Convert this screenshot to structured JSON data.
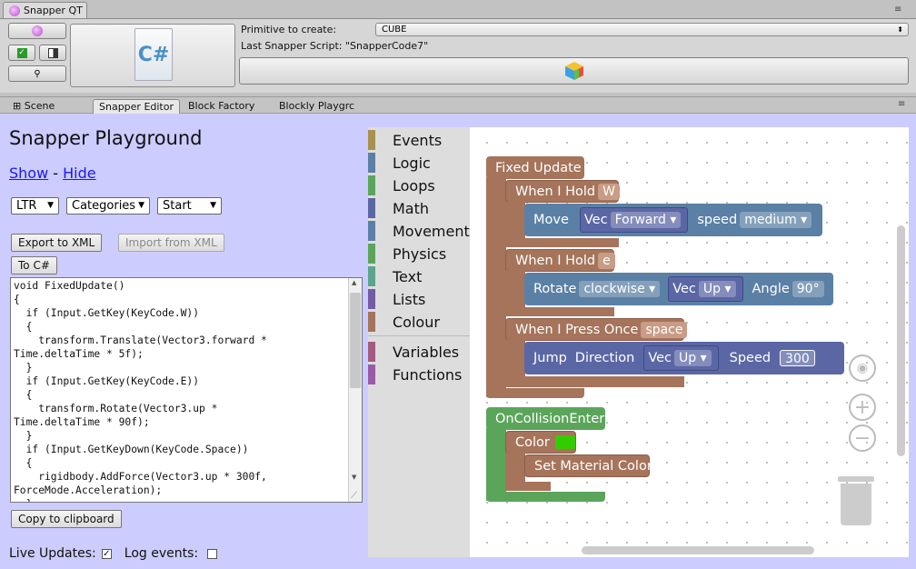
{
  "window": {
    "title": "Snapper QT"
  },
  "toolbar": {
    "primitive_label": "Primitive to create:",
    "primitive_value": "CUBE",
    "last_script_label": "Last Snapper Script: \"SnapperCode7\"",
    "csharp_icon": "C#"
  },
  "tabs": [
    "Scene",
    "Snapper Editor",
    "Block Factory",
    "Blockly Playgrc"
  ],
  "playground": {
    "title": "Snapper Playground",
    "show": "Show",
    "sep": " - ",
    "hide": "Hide",
    "dir_select": "LTR",
    "cat_select": "Categories",
    "start_select": "Start",
    "export_btn": "Export to XML",
    "import_btn": "Import from XML",
    "tocs_btn": "To C#",
    "copy_btn": "Copy to clipboard",
    "live_label": "Live Updates:",
    "log_label": "Log events:",
    "live_checked": true,
    "log_checked": false,
    "code": "void FixedUpdate()\n{\n  if (Input.GetKey(KeyCode.W))\n  {\n    transform.Translate(Vector3.forward *\nTime.deltaTime * 5f);\n  }\n  if (Input.GetKey(KeyCode.E))\n  {\n    transform.Rotate(Vector3.up *\nTime.deltaTime * 90f);\n  }\n  if (Input.GetKeyDown(KeyCode.Space))\n  {\n    rigidbody.AddForce(Vector3.up * 300f,\nForceMode.Acceleration);\n  }"
  },
  "toolbox": [
    {
      "label": "Events",
      "color": "#a8924e"
    },
    {
      "label": "Logic",
      "color": "#5b80a5"
    },
    {
      "label": "Loops",
      "color": "#5ba55b"
    },
    {
      "label": "Math",
      "color": "#5b67a5"
    },
    {
      "label": "Movement",
      "color": "#5b80a5"
    },
    {
      "label": "Physics",
      "color": "#5ba55b"
    },
    {
      "label": "Text",
      "color": "#5ba58c"
    },
    {
      "label": "Lists",
      "color": "#745ba5"
    },
    {
      "label": "Colour",
      "color": "#a5745b"
    },
    {
      "label": "Variables",
      "color": "#a55b80"
    },
    {
      "label": "Functions",
      "color": "#995ba5"
    }
  ],
  "blocks": {
    "fixed_update": "Fixed Update",
    "hold_w": {
      "label": "When I Hold",
      "key": "W"
    },
    "move": {
      "label": "Move",
      "vec": "Vec",
      "dir": "Forward",
      "speed_label": "speed",
      "speed": "medium"
    },
    "hold_e": {
      "label": "When I Hold",
      "key": "e"
    },
    "rotate": {
      "label": "Rotate",
      "dir": "clockwise",
      "vec": "Vec",
      "axis": "Up",
      "angle_label": "Angle",
      "angle": "90°"
    },
    "press_space": {
      "label": "When I Press Once",
      "key": "space"
    },
    "jump": {
      "label": "Jump",
      "dir_label": "Direction",
      "vec": "Vec",
      "axis": "Up",
      "speed_label": "Speed",
      "speed": "300"
    },
    "collision": "OnCollisionEnter",
    "color": {
      "label": "Color",
      "swatch": "#33cc00"
    },
    "set_material": "Set Material Color"
  }
}
